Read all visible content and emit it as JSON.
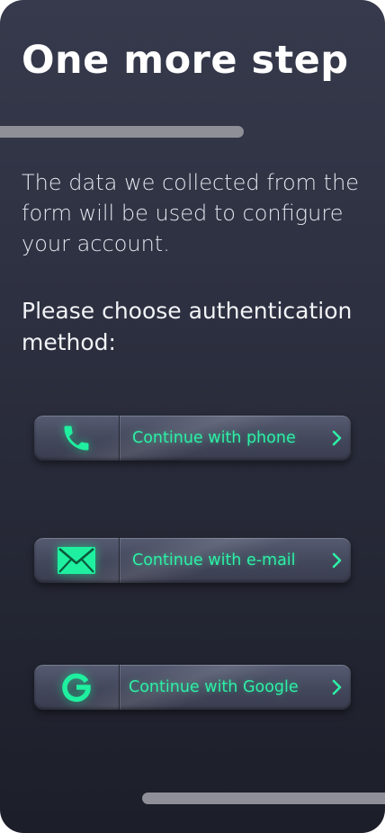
{
  "header": {
    "title": "One more step"
  },
  "progress": {
    "top_bar_fraction": 0.63
  },
  "intro": {
    "text": "The data we collected from the form will be used to configure your account."
  },
  "prompt": {
    "text": "Please choose authentication method:"
  },
  "auth_options": [
    {
      "label": "Continue with phone",
      "icon": "phone-icon"
    },
    {
      "label": "Continue with e-mail",
      "icon": "envelope-icon"
    },
    {
      "label": "Continue with Google",
      "icon": "google-icon"
    }
  ],
  "colors": {
    "accent": "#2ef0a6",
    "background_top": "#363a4c",
    "background_bottom": "#1c1e29",
    "progress": "#8f9097"
  }
}
